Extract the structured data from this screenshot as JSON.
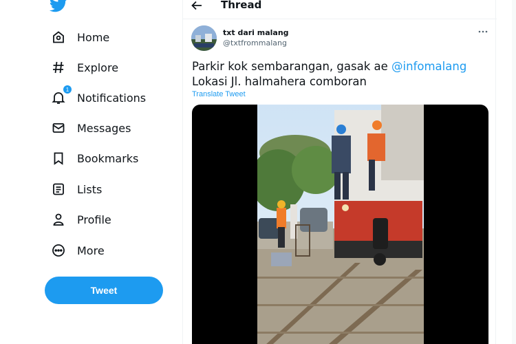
{
  "app": {
    "logo_icon": "twitter-bird-icon",
    "brand_color": "#1d9bf0"
  },
  "sidebar": {
    "items": [
      {
        "label": "Home",
        "icon": "home-icon"
      },
      {
        "label": "Explore",
        "icon": "hashtag-icon"
      },
      {
        "label": "Notifications",
        "icon": "bell-icon",
        "badge": "1"
      },
      {
        "label": "Messages",
        "icon": "envelope-icon"
      },
      {
        "label": "Bookmarks",
        "icon": "bookmark-icon"
      },
      {
        "label": "Lists",
        "icon": "list-icon"
      },
      {
        "label": "Profile",
        "icon": "person-icon"
      },
      {
        "label": "More",
        "icon": "more-circle-icon"
      }
    ],
    "tweet_button": "Tweet"
  },
  "header": {
    "title": "Thread",
    "back_icon": "arrow-left-icon"
  },
  "tweet": {
    "display_name": "txt dari malang",
    "handle": "@txtfrommalang",
    "text_part1": "Parkir kok sembarangan, gasak ae ",
    "mention": "@infomalang",
    "text_part2": "Lokasi Jl. halmahera comboran",
    "translate_label": "Translate Tweet",
    "more_icon": "more-horizontal-icon"
  }
}
